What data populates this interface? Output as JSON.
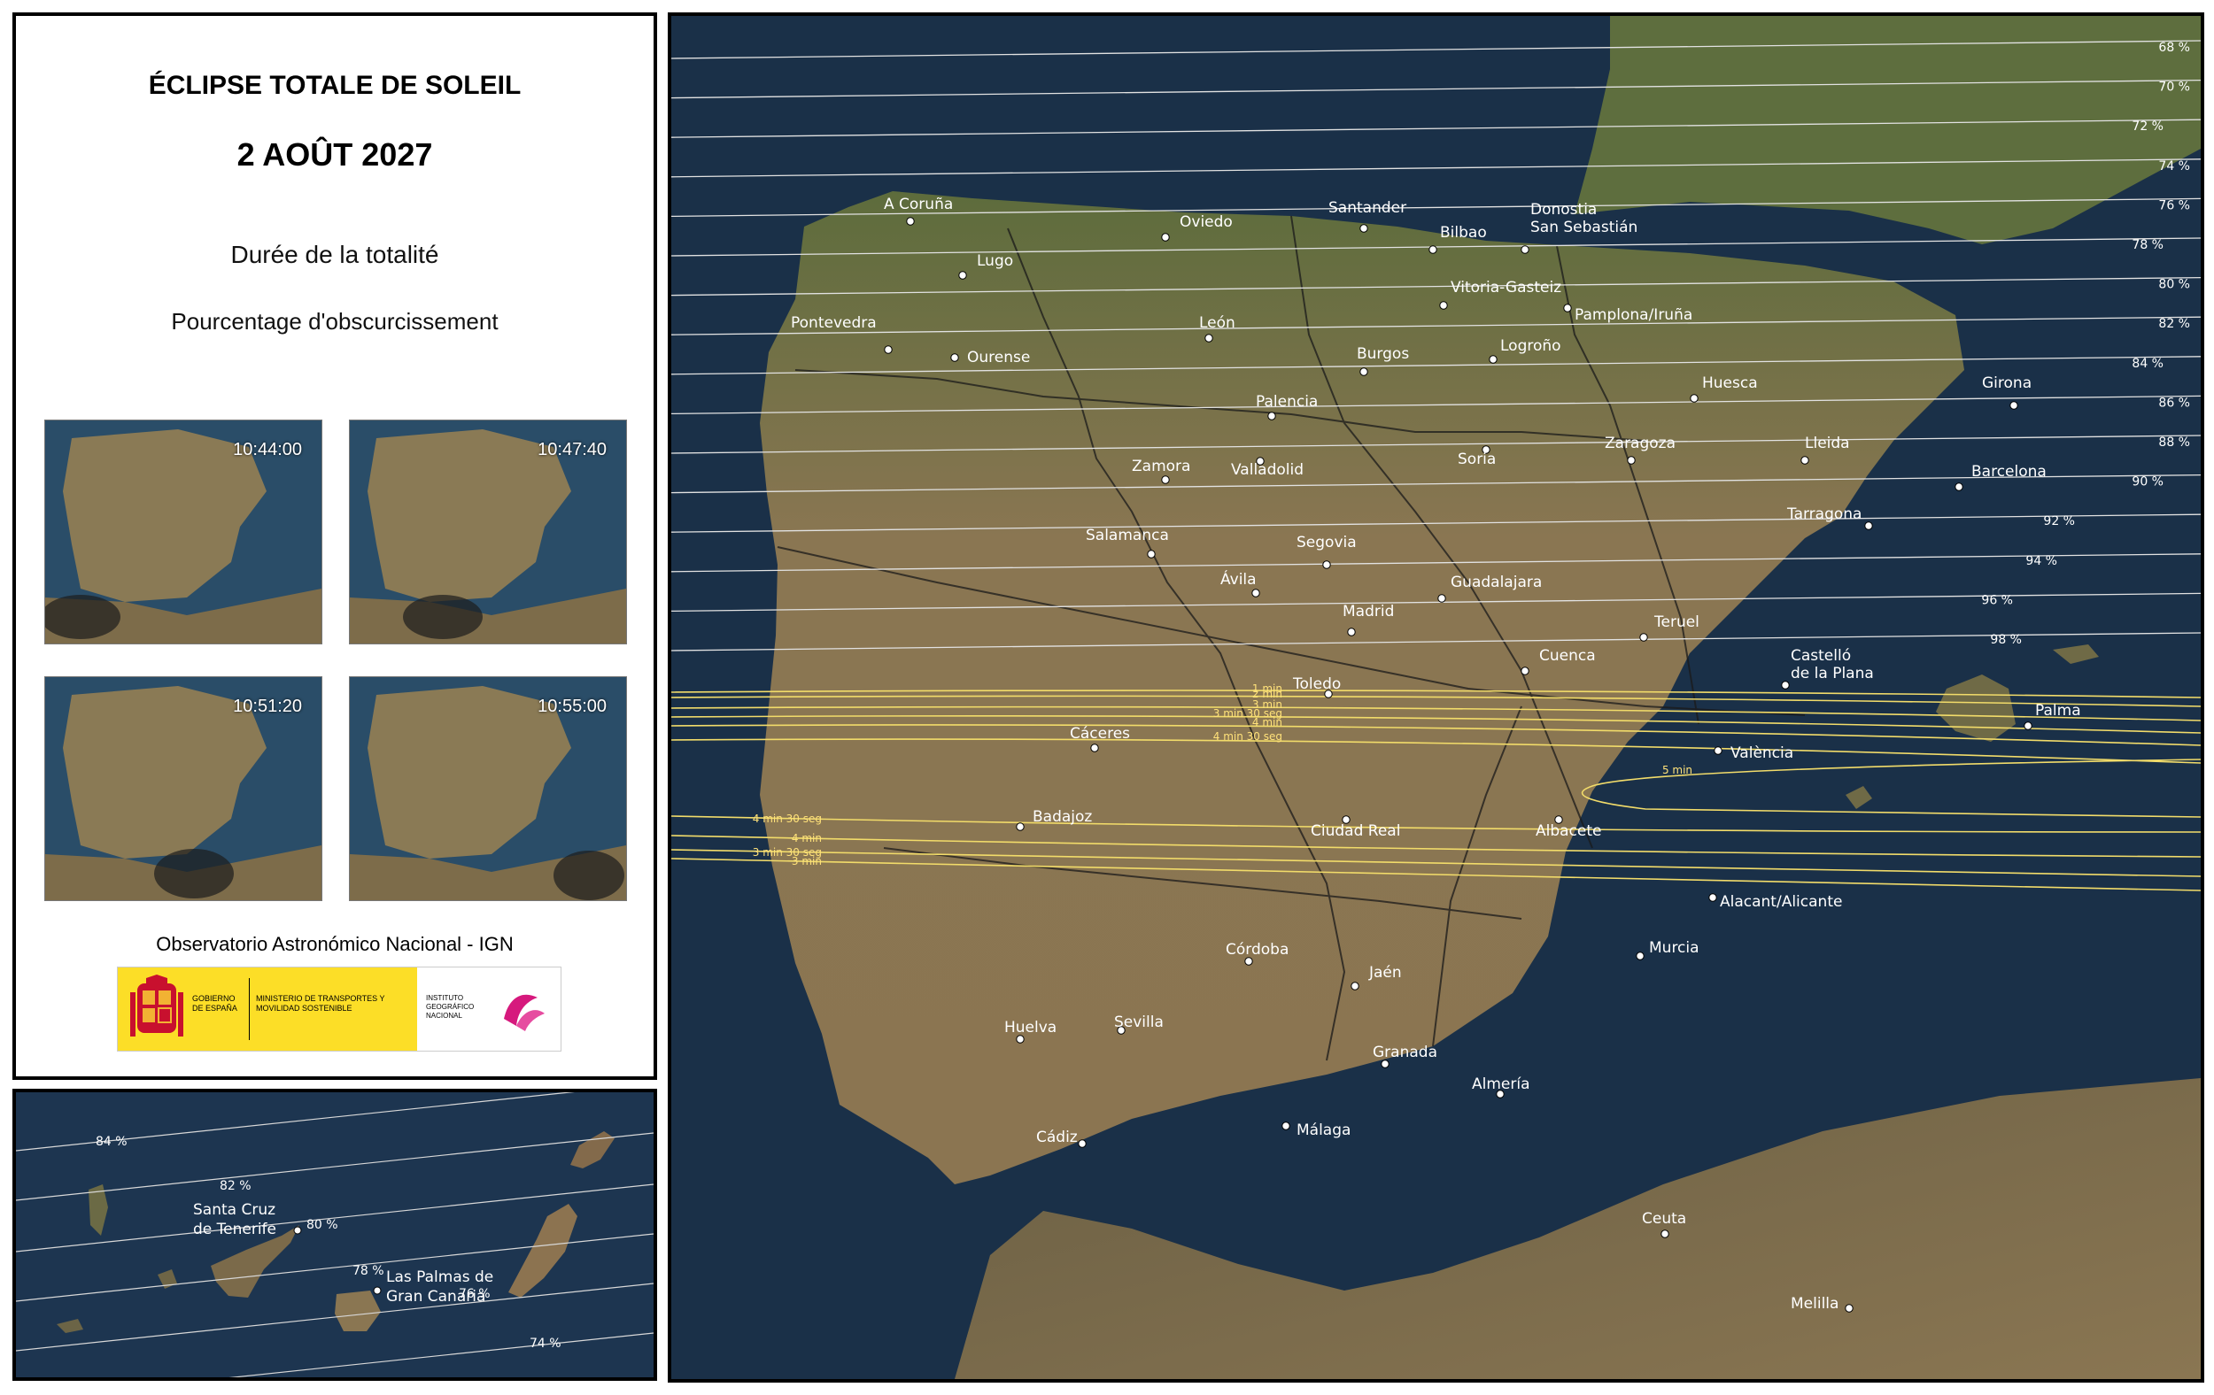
{
  "header": {
    "title": "ÉCLIPSE TOTALE DE SOLEIL",
    "date": "2 AOÛT 2027",
    "legend_duration": "Durée de la totalité",
    "legend_obscuration": "Pourcentage d'obscurcissement"
  },
  "thumbnails": [
    {
      "time": "10:44:00"
    },
    {
      "time": "10:47:40"
    },
    {
      "time": "10:51:20"
    },
    {
      "time": "10:55:00"
    }
  ],
  "footer": {
    "observatory": "Observatorio Astronómico Nacional - IGN",
    "logo_gobierno": "GOBIERNO DE ESPAÑA",
    "logo_ministerio": "MINISTERIO DE TRANSPORTES Y MOVILIDAD SOSTENIBLE",
    "logo_instituto": "INSTITUTO GEOGRÁFICO NACIONAL"
  },
  "map": {
    "obscuration_lines": [
      {
        "label": "68 %"
      },
      {
        "label": "70 %"
      },
      {
        "label": "72 %"
      },
      {
        "label": "74 %"
      },
      {
        "label": "76 %"
      },
      {
        "label": "78 %"
      },
      {
        "label": "80 %"
      },
      {
        "label": "82 %"
      },
      {
        "label": "84 %"
      },
      {
        "label": "86 %"
      },
      {
        "label": "88 %"
      },
      {
        "label": "90 %"
      },
      {
        "label": "92 %"
      },
      {
        "label": "94 %"
      },
      {
        "label": "96 %"
      },
      {
        "label": "98 %"
      }
    ],
    "duration_lines_north": [
      {
        "label": "1 min"
      },
      {
        "label": "2 min"
      },
      {
        "label": "3 min"
      },
      {
        "label": "3 min 30 seg"
      },
      {
        "label": "4 min"
      },
      {
        "label": "4 min 30 seg"
      }
    ],
    "duration_center": {
      "label": "5 min"
    },
    "duration_lines_south": [
      {
        "label": "4 min 30 seg"
      },
      {
        "label": "4 min"
      },
      {
        "label": "3 min 30 seg"
      },
      {
        "label": "3 min"
      }
    ],
    "cities": [
      {
        "name": "A Coruña"
      },
      {
        "name": "Lugo"
      },
      {
        "name": "Oviedo"
      },
      {
        "name": "Santander"
      },
      {
        "name": "Bilbao"
      },
      {
        "name": "Donostia"
      },
      {
        "name": "San Sebastián"
      },
      {
        "name": "Pontevedra"
      },
      {
        "name": "Ourense"
      },
      {
        "name": "León"
      },
      {
        "name": "Vitoria-Gasteiz"
      },
      {
        "name": "Pamplona/Iruña"
      },
      {
        "name": "Burgos"
      },
      {
        "name": "Logroño"
      },
      {
        "name": "Huesca"
      },
      {
        "name": "Girona"
      },
      {
        "name": "Palencia"
      },
      {
        "name": "Zamora"
      },
      {
        "name": "Valladolid"
      },
      {
        "name": "Soria"
      },
      {
        "name": "Zaragoza"
      },
      {
        "name": "Lleida"
      },
      {
        "name": "Barcelona"
      },
      {
        "name": "Tarragona"
      },
      {
        "name": "Salamanca"
      },
      {
        "name": "Segovia"
      },
      {
        "name": "Ávila"
      },
      {
        "name": "Guadalajara"
      },
      {
        "name": "Madrid"
      },
      {
        "name": "Teruel"
      },
      {
        "name": "Cuenca"
      },
      {
        "name": "Castelló"
      },
      {
        "name": "de la Plana"
      },
      {
        "name": "Toledo"
      },
      {
        "name": "Palma"
      },
      {
        "name": "Cáceres"
      },
      {
        "name": "València"
      },
      {
        "name": "Badajoz"
      },
      {
        "name": "Ciudad Real"
      },
      {
        "name": "Albacete"
      },
      {
        "name": "Alacant/Alicante"
      },
      {
        "name": "Córdoba"
      },
      {
        "name": "Murcia"
      },
      {
        "name": "Jaén"
      },
      {
        "name": "Huelva"
      },
      {
        "name": "Sevilla"
      },
      {
        "name": "Granada"
      },
      {
        "name": "Almería"
      },
      {
        "name": "Cádiz"
      },
      {
        "name": "Málaga"
      },
      {
        "name": "Ceuta"
      },
      {
        "name": "Melilla"
      }
    ]
  },
  "canary": {
    "obscuration_lines": [
      {
        "label": "84 %"
      },
      {
        "label": "82 %"
      },
      {
        "label": "80 %"
      },
      {
        "label": "78 %"
      },
      {
        "label": "76 %"
      },
      {
        "label": "74 %"
      }
    ],
    "cities": [
      {
        "name": "Santa Cruz"
      },
      {
        "name": "de Tenerife"
      },
      {
        "name": "Las Palmas de"
      },
      {
        "name": "Gran Canaria"
      }
    ]
  },
  "colors": {
    "sea": "#1a3048",
    "land": "#8a7652",
    "obscuration_line": "#dcdcdc",
    "duration_line": "#f2dc6a",
    "logo_yellow": "#fcde27"
  }
}
